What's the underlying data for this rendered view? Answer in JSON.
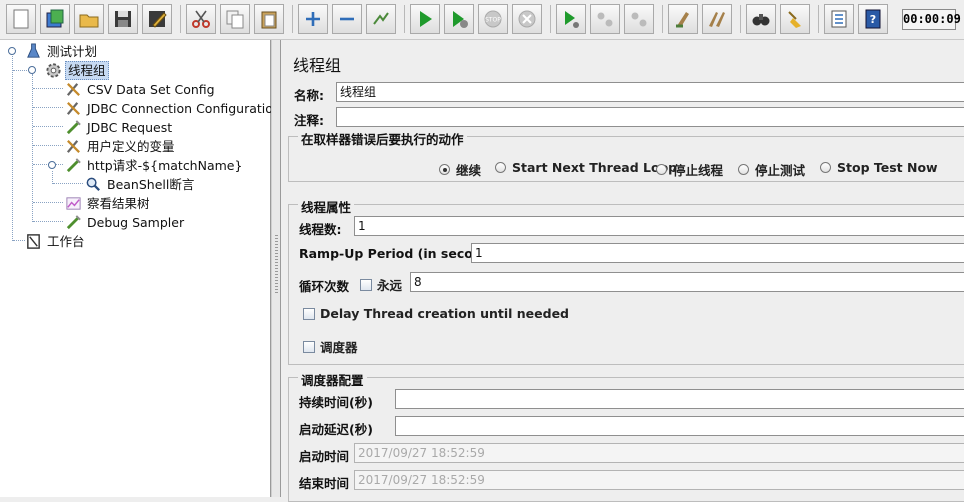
{
  "toolbar": {
    "timer": "00:00:09",
    "buttons": [
      "new-icon",
      "templates-icon",
      "open-icon",
      "save-icon",
      "save-as-icon",
      "cut-icon",
      "copy-icon",
      "paste-icon",
      "expand-icon",
      "collapse-icon",
      "toggle-icon",
      "start-icon",
      "start-no-pause-icon",
      "stop-icon",
      "shutdown-icon",
      "remote-start-icon",
      "remote-stop-icon",
      "remote-shutdown-icon",
      "clear-icon",
      "clear-all-icon",
      "search-icon",
      "reset-search-icon",
      "function-helper-icon",
      "help-icon"
    ],
    "colors": {
      "run": "#1f9a2c",
      "accent": "#3b6fb6"
    }
  },
  "tree": {
    "items": [
      {
        "label": "测试计划",
        "icon": "test-plan-icon"
      },
      {
        "label": "线程组",
        "icon": "thread-group-icon",
        "selected": true
      },
      {
        "label": "CSV Data Set Config",
        "icon": "config-element-icon"
      },
      {
        "label": "JDBC Connection Configuration",
        "icon": "config-element-icon"
      },
      {
        "label": "JDBC Request",
        "icon": "sampler-icon"
      },
      {
        "label": "用户定义的变量",
        "icon": "config-element-icon"
      },
      {
        "label": "http请求-${matchName}",
        "icon": "sampler-icon"
      },
      {
        "label": "BeanShell断言",
        "icon": "assertion-icon"
      },
      {
        "label": "察看结果树",
        "icon": "listener-icon"
      },
      {
        "label": "Debug Sampler",
        "icon": "sampler-icon"
      },
      {
        "label": "工作台",
        "icon": "workbench-icon"
      }
    ]
  },
  "panel": {
    "title": "线程组",
    "name_label": "名称:",
    "name_value": "线程组",
    "comment_label": "注释:",
    "comment_value": "",
    "error_action": {
      "title": "在取样器错误后要执行的动作",
      "options": [
        "继续",
        "Start Next Thread Loop",
        "停止线程",
        "停止测试",
        "Stop Test Now"
      ],
      "selected": "继续"
    },
    "thread_props": {
      "title": "线程属性",
      "threads_label": "线程数:",
      "threads_value": "1",
      "rampup_label": "Ramp-Up Period (in seconds):",
      "rampup_value": "1",
      "loop_label": "循环次数",
      "forever_label": "永远",
      "forever_checked": false,
      "loop_value": "8",
      "delay_label": "Delay Thread creation until needed",
      "delay_checked": false,
      "scheduler_label": "调度器",
      "scheduler_checked": false
    },
    "scheduler": {
      "title": "调度器配置",
      "duration_label": "持续时间(秒)",
      "duration_value": "",
      "delay_label": "启动延迟(秒)",
      "delay_value": "",
      "start_label": "启动时间",
      "start_value": "2017/09/27 18:52:59",
      "end_label": "结束时间",
      "end_value": "2017/09/27 18:52:59"
    }
  }
}
